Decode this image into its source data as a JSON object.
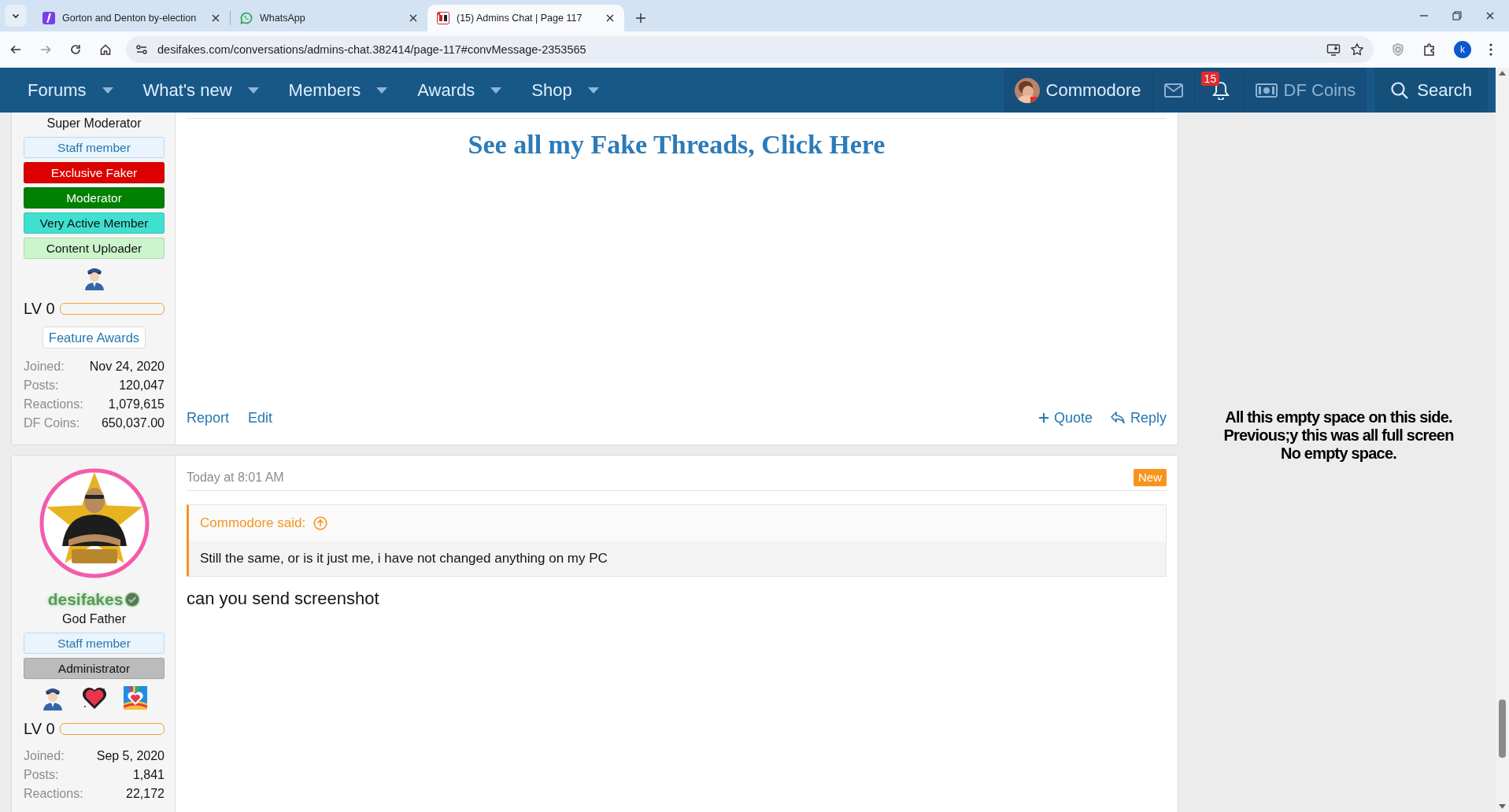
{
  "browser": {
    "tabs": [
      {
        "title": "Gorton and Denton by-election",
        "selected": false
      },
      {
        "title": "WhatsApp",
        "selected": false
      },
      {
        "title": "(15) Admins Chat | Page 117",
        "selected": true
      }
    ],
    "url": "desifakes.com/conversations/admins-chat.382414/page-117#convMessage-2353565",
    "profile_initial": "k"
  },
  "nav": {
    "items": [
      "Forums",
      "What's new",
      "Members",
      "Awards",
      "Shop"
    ],
    "user": "Commodore",
    "alert_count": "15",
    "coins_label": "DF Coins",
    "search_label": "Search"
  },
  "messages": [
    {
      "user": {
        "title": "Super Moderator",
        "banners": [
          {
            "label": "Staff member",
            "kind": "staff",
            "color": "#eaf4fd"
          },
          {
            "label": "Exclusive Faker",
            "kind": "banner",
            "color": "#dc0000"
          },
          {
            "label": "Moderator",
            "kind": "banner",
            "color": "#008000"
          },
          {
            "label": "Very Active Member",
            "kind": "banner",
            "color": "#40e0d0"
          },
          {
            "label": "Content Uploader",
            "kind": "banner",
            "color": "#ccf5cc"
          }
        ],
        "awards": [
          {
            "kind": "officer"
          }
        ],
        "level_label": "LV 0",
        "level": 0,
        "feature_awards_label": "Feature Awards",
        "stats": [
          {
            "label": "Joined:",
            "value": "Nov 24, 2020"
          },
          {
            "label": "Posts:",
            "value": "120,047"
          },
          {
            "label": "Reactions:",
            "value": "1,079,615"
          },
          {
            "label": "DF Coins:",
            "value": "650,037.00"
          }
        ]
      },
      "signature_link": "See all my Fake Threads, Click Here",
      "actions": {
        "left": [
          "Report",
          "Edit"
        ],
        "right": [
          "Quote",
          "Reply"
        ]
      }
    },
    {
      "user": {
        "name": "desifakes",
        "verified": true,
        "title": "God Father",
        "banners": [
          {
            "label": "Staff member",
            "kind": "staff",
            "color": "#eaf4fd"
          },
          {
            "label": "Administrator",
            "kind": "banner",
            "color": "#bbbbbb"
          }
        ],
        "awards": [
          {
            "kind": "officer"
          },
          {
            "kind": "heart"
          },
          {
            "kind": "heart-tile"
          }
        ],
        "level_label": "LV 0",
        "level": 0,
        "stats": [
          {
            "label": "Joined:",
            "value": "Sep 5, 2020"
          },
          {
            "label": "Posts:",
            "value": "1,841"
          },
          {
            "label": "Reactions:",
            "value": "22,172"
          }
        ]
      },
      "time": "Today at 8:01 AM",
      "new_label": "New",
      "quote": {
        "author": "Commodore said:",
        "text": "Still the same, or is it just me, i have not changed anything on my PC"
      },
      "body": "can you send screenshot"
    }
  ],
  "note": [
    "All this empty space on this side.",
    "Previous;y this was all full screen",
    "No empty space."
  ]
}
